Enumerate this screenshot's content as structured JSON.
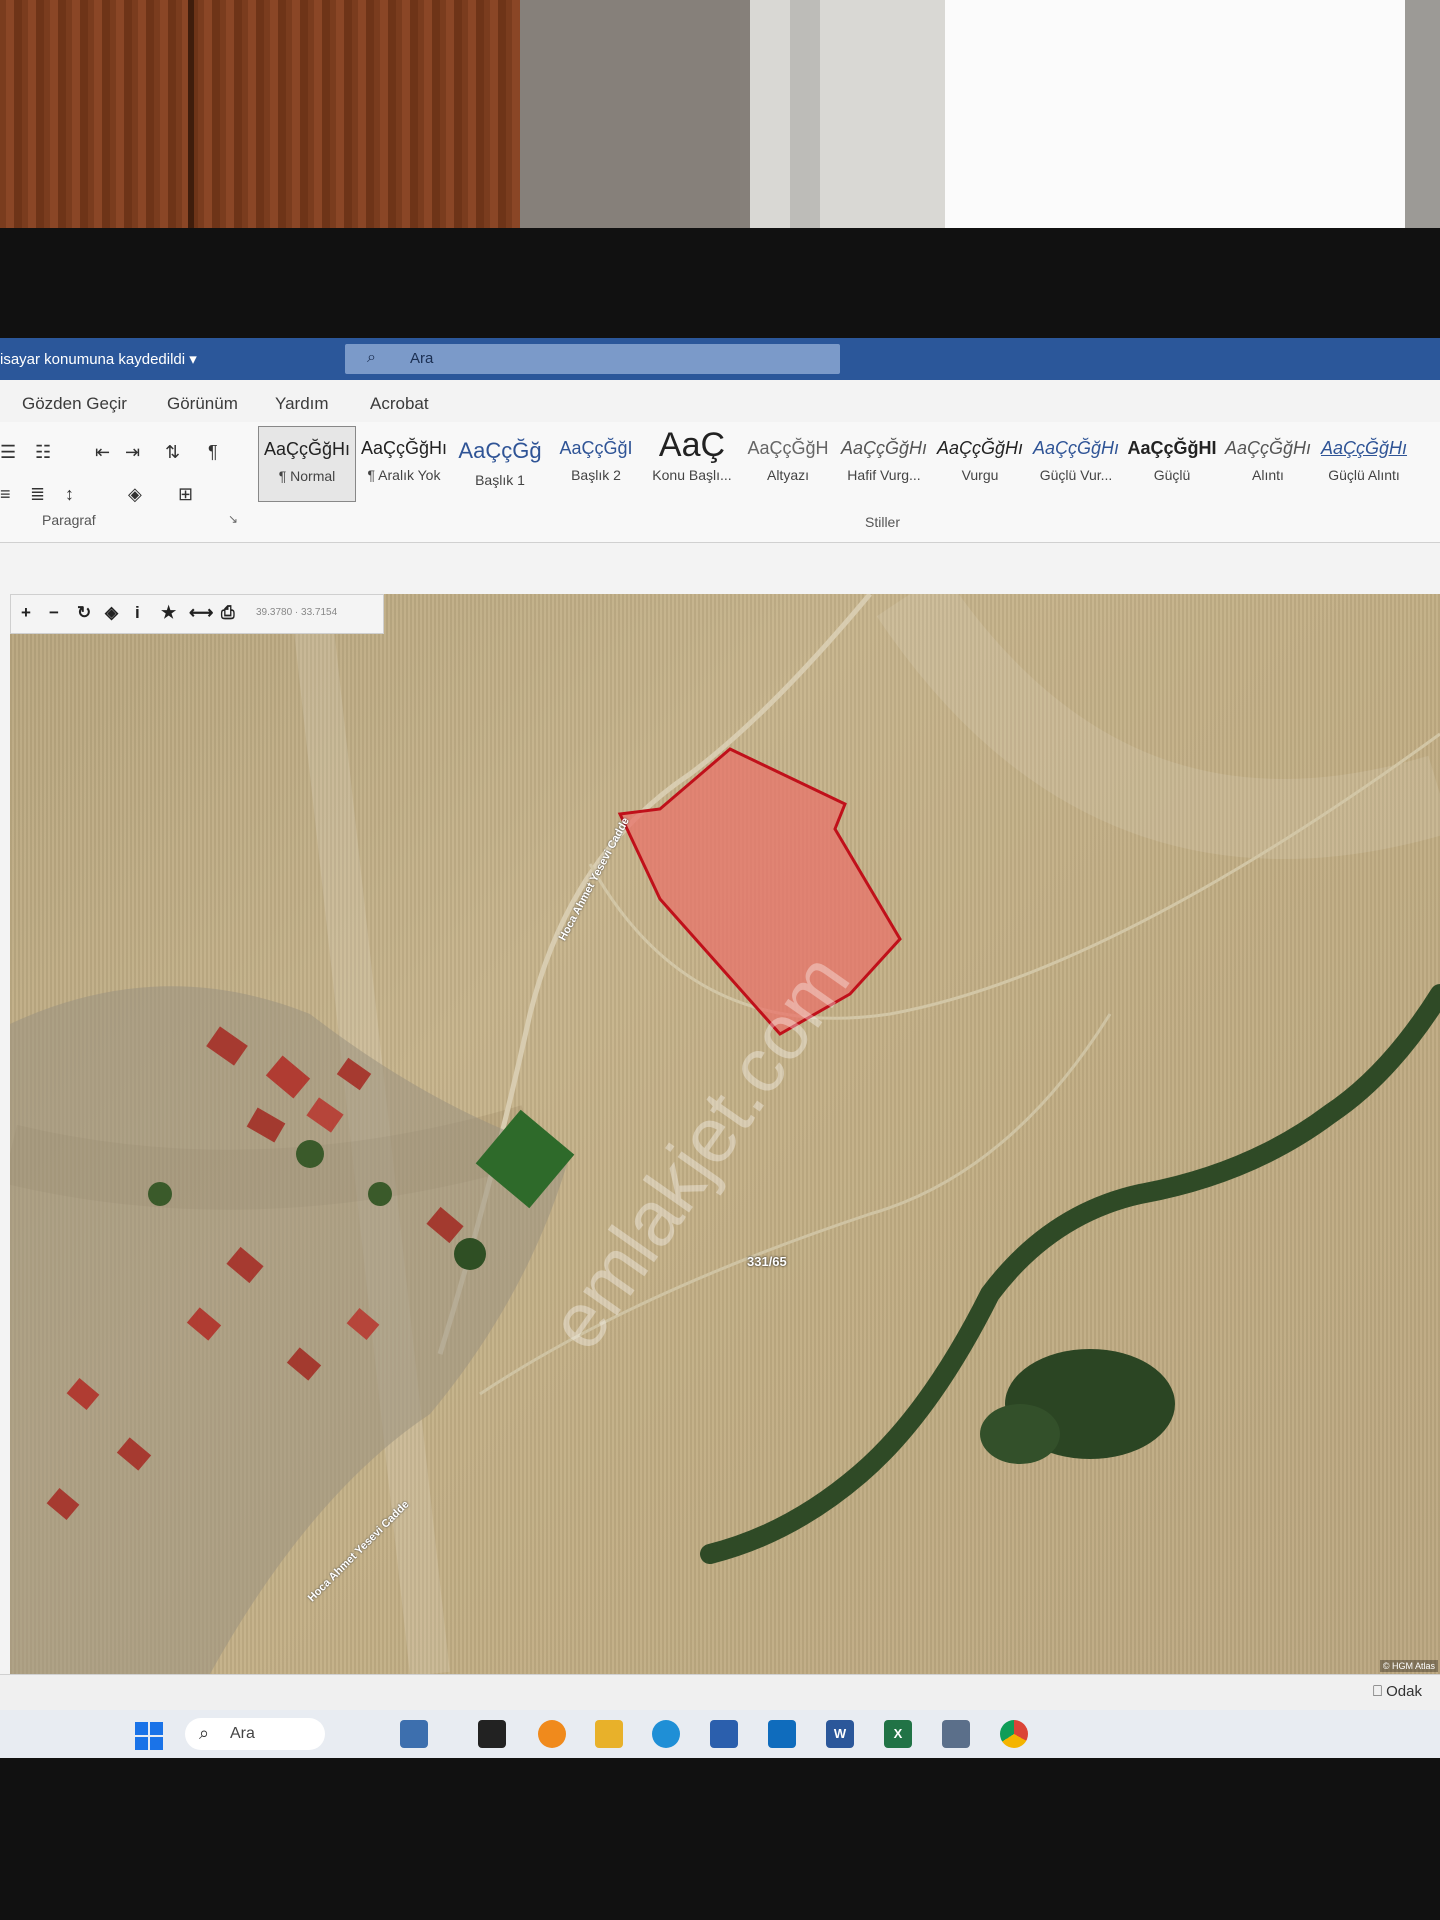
{
  "titlebar": {
    "doc_status": "isayar konumuna kaydedildi ▾",
    "search_placeholder": "Ara"
  },
  "tabs": [
    "Gözden Geçir",
    "Görünüm",
    "Yardım",
    "Acrobat"
  ],
  "ribbon": {
    "paragraph_label": "Paragraf",
    "styles_label": "Stiller",
    "styles": [
      {
        "sample": "AaÇçĞğHı",
        "name": "¶ Normal"
      },
      {
        "sample": "AaÇçĞğHı",
        "name": "¶ Aralık Yok"
      },
      {
        "sample": "AaÇçĞğ",
        "name": "Başlık 1"
      },
      {
        "sample": "AaÇçĞğI",
        "name": "Başlık 2"
      },
      {
        "sample": "AaÇ",
        "name": "Konu Başlı..."
      },
      {
        "sample": "AaÇçĞğH",
        "name": "Altyazı"
      },
      {
        "sample": "AaÇçĞğHı",
        "name": "Hafif Vurg..."
      },
      {
        "sample": "AaÇçĞğHı",
        "name": "Vurgu"
      },
      {
        "sample": "AaÇçĞğHı",
        "name": "Güçlü Vur..."
      },
      {
        "sample": "AaÇçĞğHI",
        "name": "Güçlü"
      },
      {
        "sample": "AaÇçĞğHı",
        "name": "Alıntı"
      },
      {
        "sample": "AaÇçĞğHı",
        "name": "Güçlü Alıntı"
      }
    ]
  },
  "map": {
    "toolbar": [
      "+",
      "−",
      "↻",
      "◈",
      "i",
      "★",
      "⟷",
      "⎙"
    ],
    "coords": "39.3780 · 33.7154",
    "parcel_label": "331/65",
    "road_name_1": "Hoca Ahmet Yesevi Cadde",
    "road_name_2": "Hoca Ahmet Yesevi Cadde",
    "watermark": "emlakjet.com",
    "attribution": "© HGM Atlas"
  },
  "statusbar": {
    "focus": "Odak"
  },
  "taskbar": {
    "search_placeholder": "Ara",
    "apps": [
      "W",
      "X"
    ]
  },
  "colors": {
    "titlebar": "#2b579a",
    "parcel_fill": "#e8736a",
    "parcel_stroke": "#c0101a"
  }
}
